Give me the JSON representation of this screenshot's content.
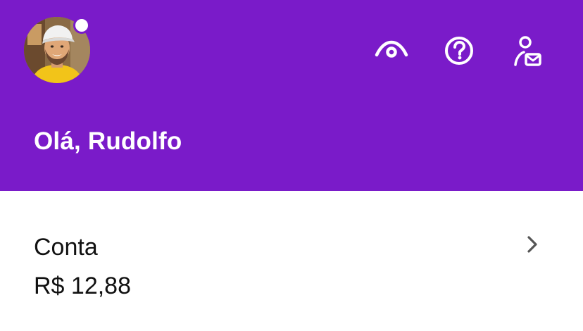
{
  "header": {
    "background_color": "#7a1bc9",
    "avatar": {
      "icon": "user-avatar-photo",
      "has_notification": true
    },
    "actions": [
      {
        "icon": "eye-icon",
        "label": ""
      },
      {
        "icon": "help-circle-icon",
        "label": ""
      },
      {
        "icon": "user-mail-icon",
        "label": ""
      }
    ],
    "greeting": "Olá, Rudolfo"
  },
  "account": {
    "title": "Conta",
    "balance": "R$ 12,88",
    "icon": "chevron-right-icon"
  }
}
